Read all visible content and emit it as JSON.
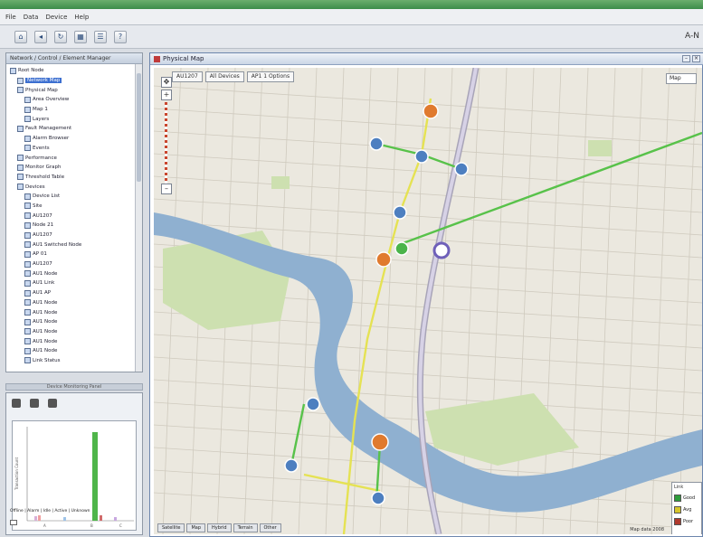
{
  "menu": {
    "items": [
      "File",
      "Data",
      "Device",
      "Help"
    ]
  },
  "toolbar": {
    "right_text": "A-N"
  },
  "left_panel": {
    "title": "Network / Control / Element Manager",
    "tree": [
      {
        "label": "Root Node",
        "indent": 0
      },
      {
        "label": "Network Map",
        "indent": 1,
        "selected": true
      },
      {
        "label": "Physical Map",
        "indent": 1
      },
      {
        "label": "Area Overview",
        "indent": 2
      },
      {
        "label": "Map 1",
        "indent": 2
      },
      {
        "label": "Layers",
        "indent": 2
      },
      {
        "label": "Fault Management",
        "indent": 1
      },
      {
        "label": "Alarm Browser",
        "indent": 2
      },
      {
        "label": "Events",
        "indent": 2
      },
      {
        "label": "Performance",
        "indent": 1
      },
      {
        "label": "Monitor Graph",
        "indent": 1
      },
      {
        "label": "Threshold Table",
        "indent": 1
      },
      {
        "label": "Devices",
        "indent": 1
      },
      {
        "label": "Device List",
        "indent": 2
      },
      {
        "label": "Site",
        "indent": 2
      },
      {
        "label": "AU1207",
        "indent": 2
      },
      {
        "label": "Node 21",
        "indent": 2
      },
      {
        "label": "AU1207",
        "indent": 2
      },
      {
        "label": "AU1 Switched Node",
        "indent": 2
      },
      {
        "label": "AP 01",
        "indent": 2
      },
      {
        "label": "AU1207",
        "indent": 2
      },
      {
        "label": "AU1 Node",
        "indent": 2
      },
      {
        "label": "AU1 Link",
        "indent": 2
      },
      {
        "label": "AU1 AP",
        "indent": 2
      },
      {
        "label": "AU1 Node",
        "indent": 2
      },
      {
        "label": "AU1 Node",
        "indent": 2
      },
      {
        "label": "AU1 Node",
        "indent": 2
      },
      {
        "label": "AU1 Node",
        "indent": 2
      },
      {
        "label": "AU1 Node",
        "indent": 2
      },
      {
        "label": "AU1 Node",
        "indent": 2
      },
      {
        "label": "Link Status",
        "indent": 2
      }
    ]
  },
  "splitter_label": "Device Monitoring Panel",
  "bottom_chart": {
    "y_label": "Transaction Count",
    "categories": [
      "A",
      "B",
      "C"
    ],
    "legend": [
      "Offline",
      "Alarm",
      "Idle",
      "Active",
      "Unknown"
    ],
    "legend_text": "Offline | Alarm | Idle | Active | Unknown"
  },
  "map_window": {
    "title": "Physical Map",
    "toolbar": [
      "AU1207",
      "All Devices",
      "AP1 1 Options"
    ],
    "dropdown": "Map",
    "tabs": [
      "Satellite",
      "Map",
      "Hybrid",
      "Terrain",
      "Other"
    ],
    "status": "Map data 2008",
    "legend_title": "Link",
    "legend": [
      {
        "label": "Good",
        "color": "#2e9d3c"
      },
      {
        "label": "Avg",
        "color": "#d7c62c"
      },
      {
        "label": "Poor",
        "color": "#b03a2e"
      }
    ]
  },
  "colors": {
    "river": "#8fb0d0",
    "park": "#cde0b0",
    "green_link": "#58c24a",
    "yellow_link": "#e5e253",
    "node_blue": "#4d7fc0",
    "node_orange": "#e07a2e"
  }
}
